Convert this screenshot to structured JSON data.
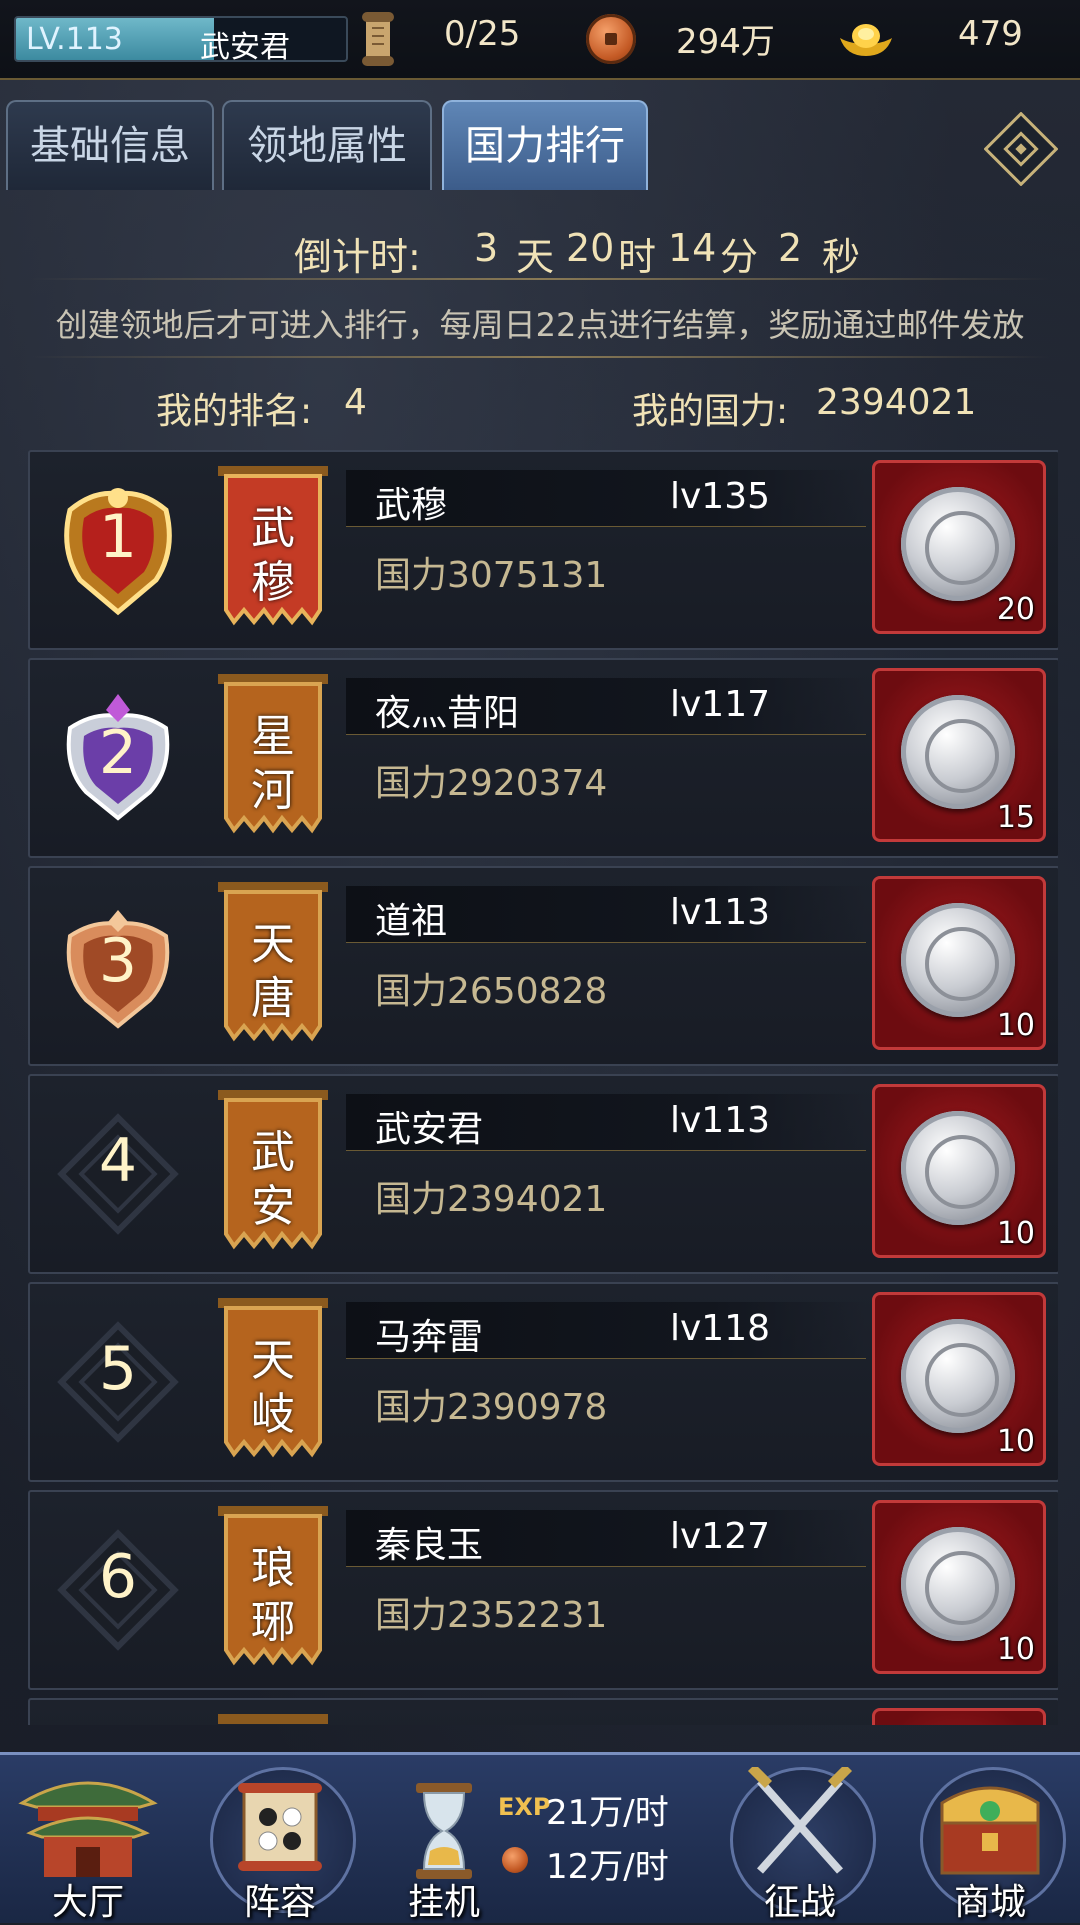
{
  "topbar": {
    "level": "LV.113",
    "level_progress": 0.6,
    "player_name": "武安君",
    "scroll_value": "0/25",
    "copper_value": "294万",
    "gold_value": "479"
  },
  "tabs": [
    {
      "label": "基础信息",
      "active": false
    },
    {
      "label": "领地属性",
      "active": false
    },
    {
      "label": "国力排行",
      "active": true
    }
  ],
  "countdown": {
    "label": "倒计时:",
    "days": "3",
    "days_unit": "天",
    "hours": "20",
    "hours_unit": "时",
    "minutes": "14",
    "minutes_unit": "分",
    "seconds": "2",
    "seconds_unit": "秒"
  },
  "notice": "创建领地后才可进入排行，每周日22点进行结算，奖励通过邮件发放",
  "my": {
    "rank_label": "我的排名:",
    "rank_value": "4",
    "power_label": "我的国力:",
    "power_value": "2394021"
  },
  "rows": [
    {
      "rank": "1",
      "banner": [
        "武",
        "穆"
      ],
      "name": "武穆",
      "level": "lv135",
      "power": "国力3075131",
      "reward": "20"
    },
    {
      "rank": "2",
      "banner": [
        "星",
        "河"
      ],
      "name": "夜灬昔阳",
      "level": "lv117",
      "power": "国力2920374",
      "reward": "15"
    },
    {
      "rank": "3",
      "banner": [
        "天",
        "唐"
      ],
      "name": "道祖",
      "level": "lv113",
      "power": "国力2650828",
      "reward": "10"
    },
    {
      "rank": "4",
      "banner": [
        "武",
        "安"
      ],
      "name": "武安君",
      "level": "lv113",
      "power": "国力2394021",
      "reward": "10"
    },
    {
      "rank": "5",
      "banner": [
        "天",
        "岐"
      ],
      "name": "马奔雷",
      "level": "lv118",
      "power": "国力2390978",
      "reward": "10"
    },
    {
      "rank": "6",
      "banner": [
        "琅",
        "琊"
      ],
      "name": "秦良玉",
      "level": "lv127",
      "power": "国力2352231",
      "reward": "10"
    }
  ],
  "bottom_nav": {
    "hall": "大厅",
    "lineup": "阵容",
    "idle": "挂机",
    "exp_label": "EXP",
    "exp_rate": "21万/时",
    "copper_rate": "12万/时",
    "battle": "征战",
    "shop": "商城"
  },
  "colors": {
    "gold_text": "#f0e2b6",
    "active_tab": "#4f74a6",
    "reward_red": "#a51b1f",
    "rank1": "#d9a23a",
    "rank2": "#8a5bc7",
    "rank3": "#c06a3a"
  }
}
